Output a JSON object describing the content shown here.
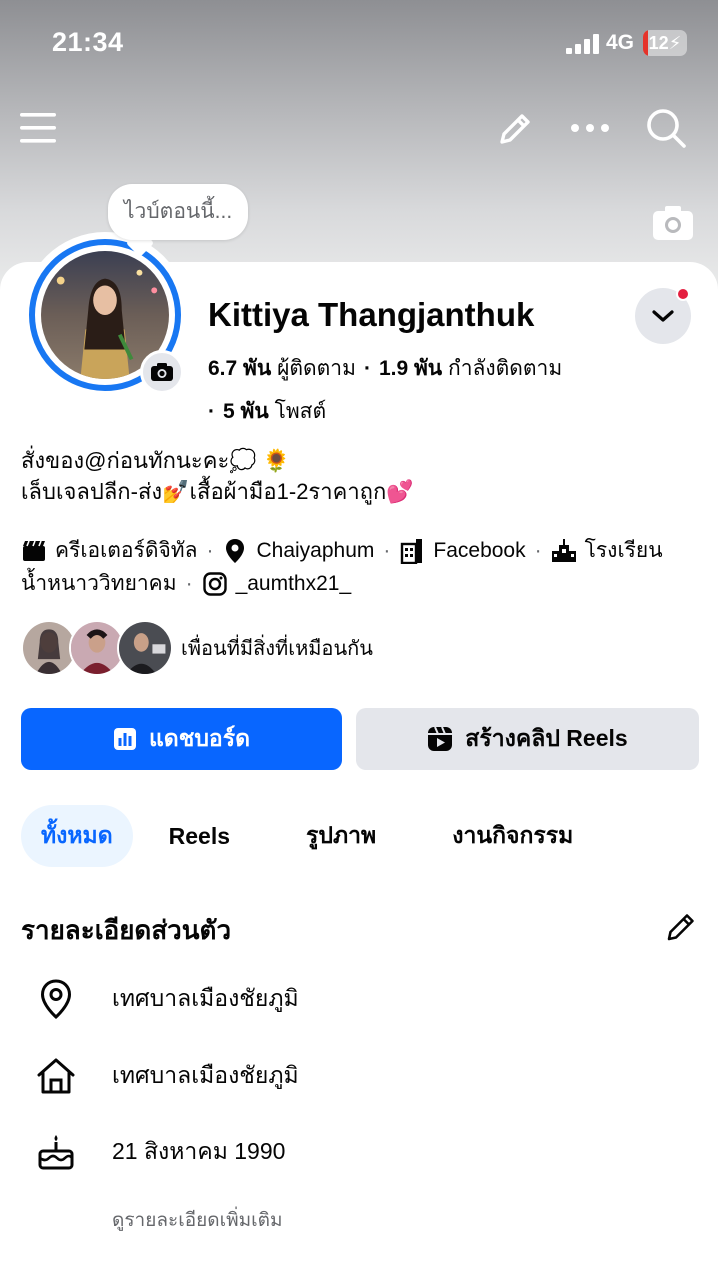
{
  "status_bar": {
    "time": "21:34",
    "network": "4G",
    "battery": "12",
    "battery_level": 0.12
  },
  "bubble": {
    "text": "ไวบ์ตอนนี้..."
  },
  "profile": {
    "name": "Kittiya Thangjanthuk",
    "followers_count": "6.7 พัน",
    "followers_label": "ผู้ติดตาม",
    "following_count": "1.9 พัน",
    "following_label": "กำลังติดตาม",
    "posts_count": "5 พัน",
    "posts_label": "โพสต์"
  },
  "bio": {
    "line1": "สั่งของ@ก่อนทักนะคะ💭 🌻",
    "line2": "เล็บเจลปลีก-ส่ง💅เสื้อผ้ามือ1-2ราคาถูก💕"
  },
  "intro": {
    "creator": "ครีเอเตอร์ดิจิทัล",
    "location": "Chaiyaphum",
    "work": "Facebook",
    "school_part1": "โรงเรียน",
    "school_part2": "น้ำหนาววิทยาคม",
    "instagram": "_aumthx21_"
  },
  "mutual": {
    "text": "เพื่อนที่มีสิ่งที่เหมือนกัน"
  },
  "buttons": {
    "dashboard": "แดชบอร์ด",
    "create_reels": "สร้างคลิป Reels"
  },
  "tabs": [
    "ทั้งหมด",
    "Reels",
    "รูปภาพ",
    "งานกิจกรรม"
  ],
  "details": {
    "title": "รายละเอียดส่วนตัว",
    "current_city": "เทศบาลเมืองชัยภูมิ",
    "hometown": "เทศบาลเมืองชัยภูมิ",
    "birthday": "21 สิงหาคม  1990",
    "see_more": "ดูรายละเอียดเพิ่มเติม"
  },
  "colors": {
    "accent": "#0866ff",
    "ring": "#1877f2",
    "secondary_bg": "#e4e6eb",
    "badge": "#e41e3f"
  }
}
